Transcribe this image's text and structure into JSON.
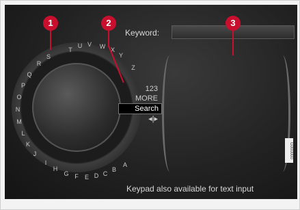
{
  "keyword_label": "Keyword:",
  "menu": [
    "123",
    "MORE",
    "Search",
    "◂|▸"
  ],
  "hint": "Keypad also available for text input",
  "callouts": [
    "1",
    "2",
    "3"
  ],
  "side_code": "G000000",
  "ring_letters": [
    "T",
    "U",
    "V",
    "W",
    "X",
    "Y",
    "Z",
    "A",
    "B",
    "C",
    "D",
    "E",
    "F",
    "G",
    "H",
    "I",
    "J",
    "K",
    "L",
    "M",
    "N",
    "O",
    "P",
    "Q",
    "R",
    "S"
  ]
}
